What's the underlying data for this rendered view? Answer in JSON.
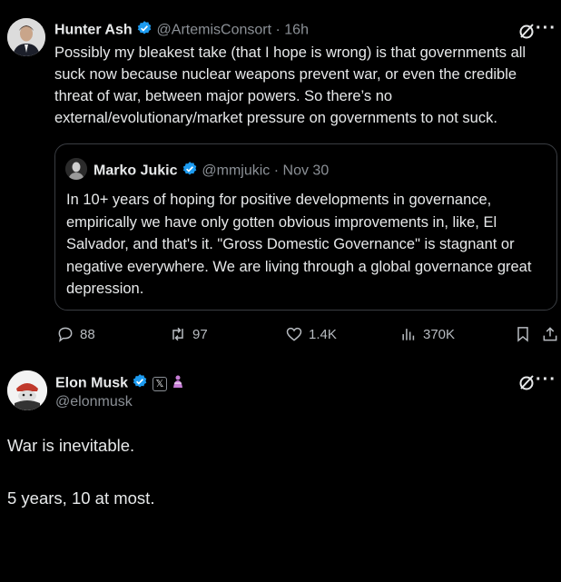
{
  "main_tweet": {
    "author_name": "Hunter Ash",
    "handle": "@ArtemisConsort",
    "separator": "·",
    "time": "16h",
    "text_lines": [
      "Possibly my bleakest take (that I hope is wrong) is that governments all",
      "suck now because nuclear weapons prevent war, or even the credible",
      "threat of war, between major powers. So there’s no",
      "external/evolutionary/market pressure on governments to not suck."
    ]
  },
  "quoted_tweet": {
    "author_name": "Marko Jukic",
    "handle": "@mmjukic",
    "separator": "·",
    "time": "Nov 30",
    "text_lines": [
      "In 10+ years of hoping for positive developments in governance,",
      "empirically we have only gotten obvious improvements in, like, El",
      "Salvador, and that's it. \"Gross Domestic Governance\" is stagnant or",
      "negative everywhere. We are living through a global governance great",
      "depression."
    ]
  },
  "actions": {
    "replies": "88",
    "reposts": "97",
    "likes": "1.4K",
    "views": "370K"
  },
  "reply_tweet": {
    "author_name": "Elon Musk",
    "handle": "@elonmusk",
    "badge_x": "𝕏",
    "line1": "War is inevitable.",
    "line2": "5 years, 10 at most."
  },
  "colors": {
    "background": "#000000",
    "text": "#e7e9ea",
    "muted": "#8b9096",
    "verified": "#1d9bf0",
    "border": "#3a3d42"
  },
  "icons": [
    "grok-icon",
    "more-icon",
    "reply-icon",
    "repost-icon",
    "like-icon",
    "views-icon",
    "bookmark-icon",
    "share-icon",
    "verified-icon",
    "x-badge-icon",
    "emoji-icon"
  ]
}
